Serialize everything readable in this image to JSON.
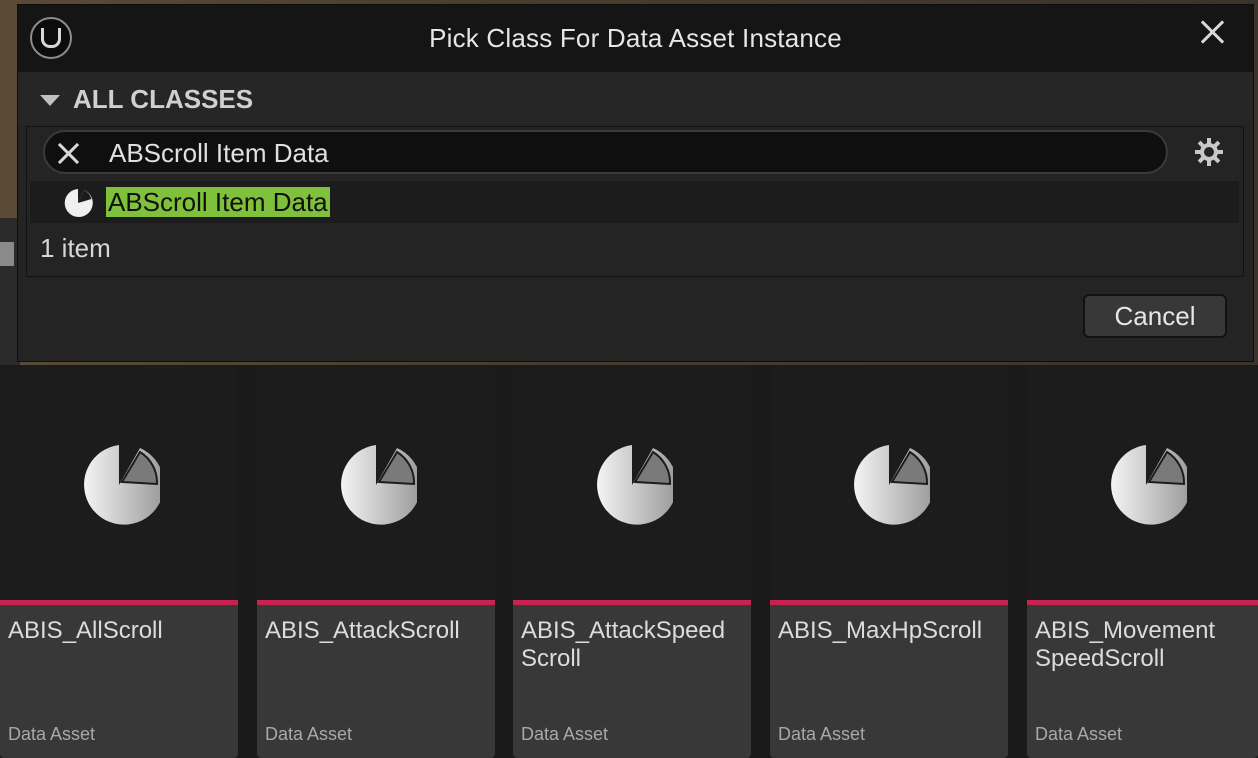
{
  "dialog": {
    "title": "Pick Class For Data Asset Instance",
    "section_label": "ALL CLASSES",
    "search_value": "ABScroll Item Data",
    "result_label": "ABScroll Item Data",
    "item_count": "1 item",
    "cancel_label": "Cancel",
    "icons": [
      "unreal-logo-icon",
      "close-icon",
      "caret-down-icon",
      "clear-search-icon",
      "gear-icon",
      "pie-chart-icon"
    ],
    "highlight_color": "#7fc13a"
  },
  "tiles": [
    {
      "name": "ABIS_AllScroll",
      "type": "Data Asset"
    },
    {
      "name": "ABIS_AttackScroll",
      "type": "Data Asset"
    },
    {
      "name": "ABIS_AttackSpeed\nScroll",
      "type": "Data Asset"
    },
    {
      "name": "ABIS_MaxHpScroll",
      "type": "Data Asset"
    },
    {
      "name": "ABIS_Movement\nSpeedScroll",
      "type": "Data Asset"
    }
  ],
  "colors": {
    "asset_bar": "#c8234e",
    "tile_info_bg": "#383838"
  }
}
